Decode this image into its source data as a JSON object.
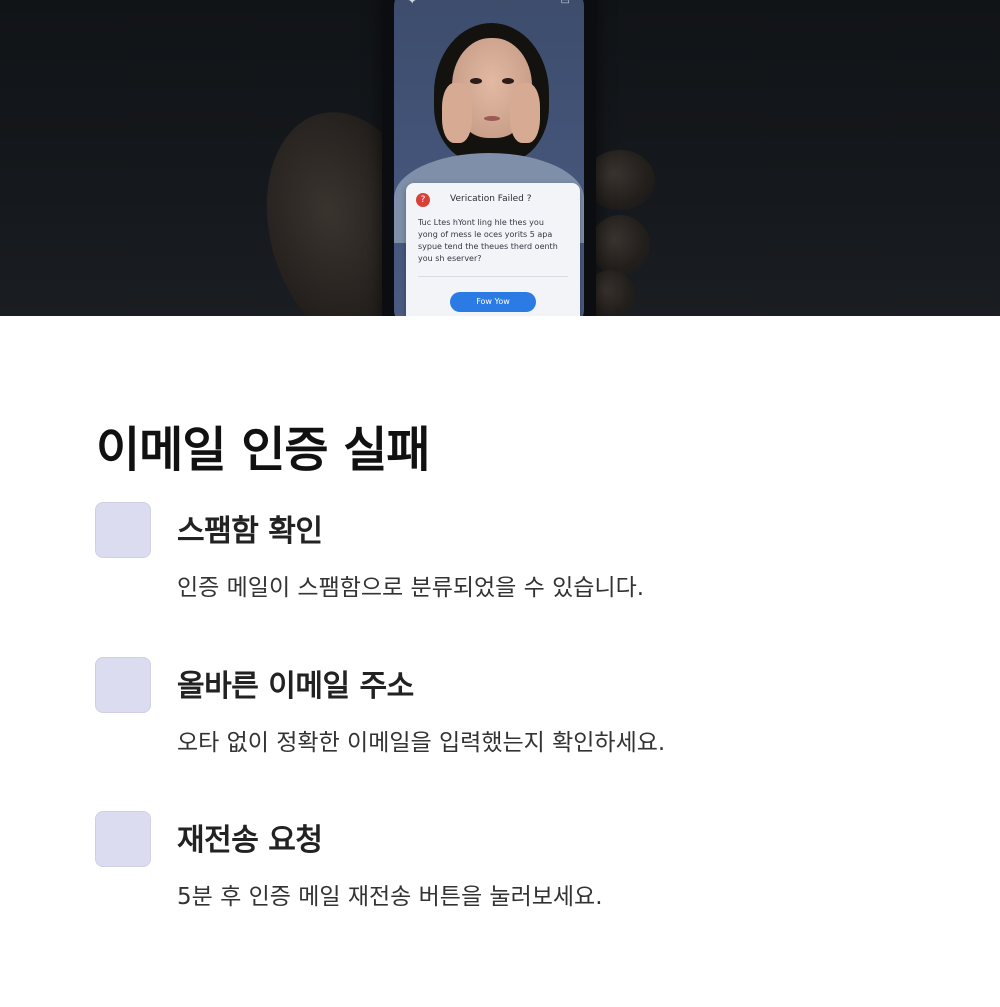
{
  "hero": {
    "image_description_icon": "phone-photo",
    "dialog": {
      "icon": "question-mark-icon",
      "icon_glyph": "?",
      "title": "Verication Failed ?",
      "body_lines": [
        "Tuc Ltes hYont ling hle thes you",
        "yong of mess le oces yorits 5 apa",
        "sypue tend the theues therd oenth",
        "you sh eserver?"
      ],
      "button": "Fow Yow"
    }
  },
  "title": "이메일 인증 실패",
  "items": [
    {
      "icon": "checkbox-placeholder-icon",
      "title": "스팸함 확인",
      "desc": "인증 메일이 스팸함으로 분류되었을 수 있습니다."
    },
    {
      "icon": "checkbox-placeholder-icon",
      "title": "올바른 이메일 주소",
      "desc": "오타 없이 정확한 이메일을 입력했는지 확인하세요."
    },
    {
      "icon": "checkbox-placeholder-icon",
      "title": "재전송 요청",
      "desc": "5분 후 인증 메일 재전송 버튼을 눌러보세요."
    }
  ],
  "colors": {
    "icon_box": "#dcdcf0",
    "title_text": "#111111",
    "dialog_button": "#2c7be5",
    "dialog_icon": "#d8403a"
  }
}
